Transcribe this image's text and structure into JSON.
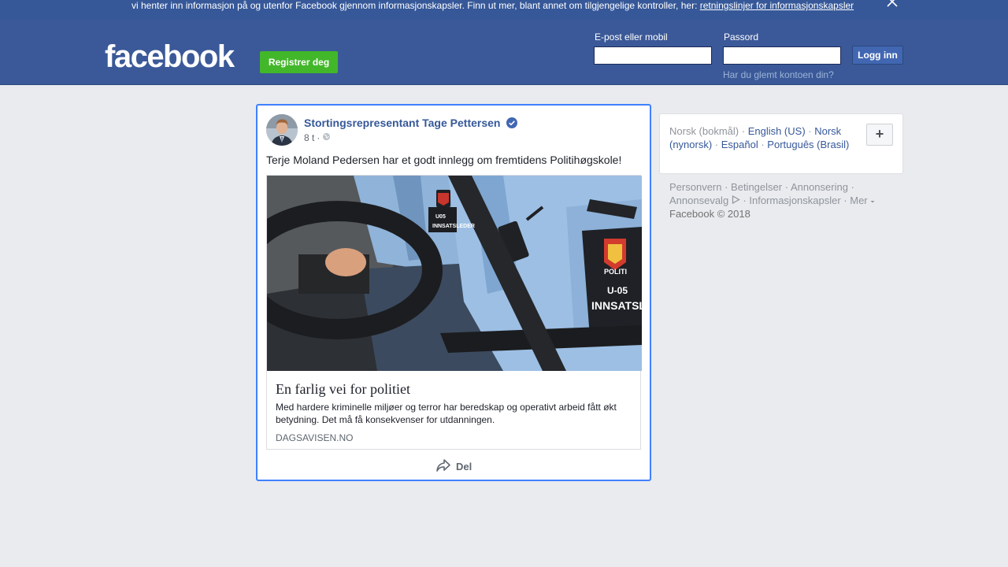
{
  "cookie_banner": {
    "text": "vi henter inn informasjon på og utenfor Facebook gjennom informasjonskapsler. Finn ut mer, blant annet om tilgjengelige kontroller, her:",
    "link": "retningslinjer for informasjonskapsler"
  },
  "header": {
    "logo": "facebook",
    "register_button": "Registrer deg",
    "email_label": "E-post eller mobil",
    "email_value": "",
    "password_label": "Passord",
    "password_value": "",
    "login_button": "Logg inn",
    "forgot_link": "Har du glemt kontoen din?"
  },
  "post": {
    "author": "Stortingsrepresentant Tage Pettersen",
    "verified": true,
    "time": "8 t",
    "separator": "·",
    "audience_icon": "globe-icon",
    "text": "Terje Moland Pedersen har et godt innlegg om fremtidens Politihøgskole!",
    "link": {
      "title": "En farlig vei for politiet",
      "description": "Med hardere kriminelle miljøer og terror har beredskap og operativt arbeid fått økt betydning. Det må få konsekvenser for utdanningen.",
      "domain": "DAGSAVISEN.NO",
      "image_text": {
        "badge_small": "U05",
        "patch_small": "INNSATSLEDER",
        "badge_large": "U-05",
        "patch_large": "INNSATSLE",
        "emblem_text": "POLITI"
      }
    },
    "share_label": "Del"
  },
  "languages": {
    "current": "Norsk (bokmål)",
    "options": [
      "English (US)",
      "Norsk (nynorsk)",
      "Español",
      "Português (Brasil)"
    ],
    "add_label": "+"
  },
  "footer": {
    "links": [
      "Personvern",
      "Betingelser",
      "Annonsering",
      "Annonsevalg",
      "Informasjonskapsler",
      "Mer"
    ],
    "copyright": "Facebook © 2018"
  },
  "colors": {
    "brand_blue": "#3b5998",
    "link_blue": "#365899",
    "register_green": "#42b72a",
    "focus_blue": "#4080ff"
  }
}
